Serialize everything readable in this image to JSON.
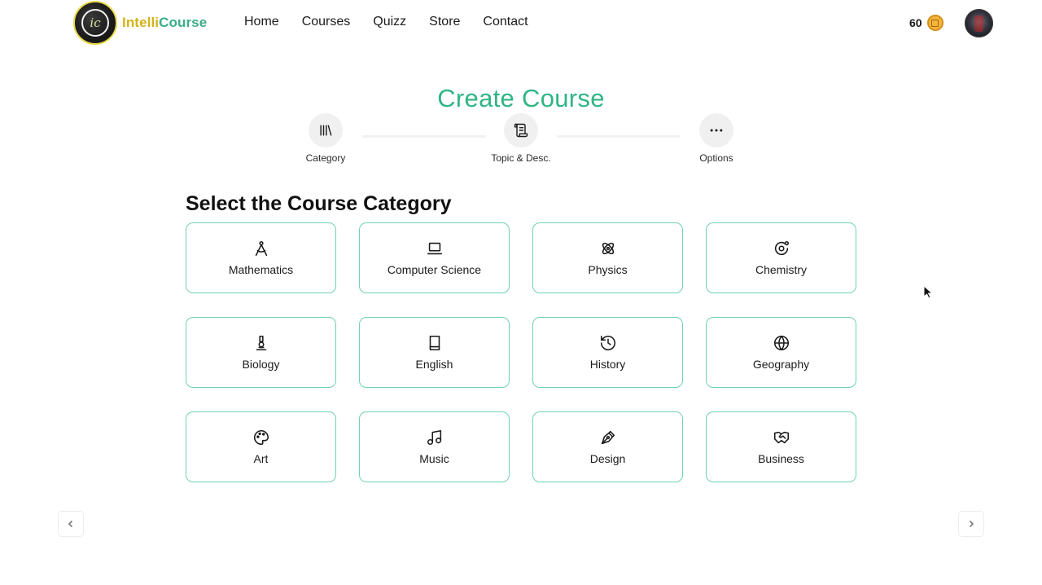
{
  "header": {
    "logo_text_a": "Intelli",
    "logo_text_b": "Course",
    "logo_mark": "ic",
    "nav": [
      "Home",
      "Courses",
      "Quizz",
      "Store",
      "Contact"
    ],
    "coins": "60",
    "coin_icon": "coin-icon",
    "avatar_icon": "user-avatar"
  },
  "page": {
    "title": "Create Course",
    "section_title": "Select the Course Category"
  },
  "stepper": [
    {
      "label": "Category",
      "icon": "library-icon"
    },
    {
      "label": "Topic & Desc.",
      "icon": "scroll-icon"
    },
    {
      "label": "Options",
      "icon": "more-icon"
    }
  ],
  "categories": [
    {
      "label": "Mathematics",
      "icon": "compass-icon"
    },
    {
      "label": "Computer Science",
      "icon": "laptop-icon"
    },
    {
      "label": "Physics",
      "icon": "atom-icon"
    },
    {
      "label": "Chemistry",
      "icon": "orbit-icon"
    },
    {
      "label": "Biology",
      "icon": "microscope-icon"
    },
    {
      "label": "English",
      "icon": "book-icon"
    },
    {
      "label": "History",
      "icon": "history-icon"
    },
    {
      "label": "Geography",
      "icon": "globe-icon"
    },
    {
      "label": "Art",
      "icon": "palette-icon"
    },
    {
      "label": "Music",
      "icon": "music-icon"
    },
    {
      "label": "Design",
      "icon": "pen-tool-icon"
    },
    {
      "label": "Business",
      "icon": "handshake-icon"
    }
  ],
  "colors": {
    "accent": "#2fb584",
    "card_border": "#6fd2b0",
    "logo_yellow": "#d4b21a",
    "logo_green": "#3aae86"
  }
}
